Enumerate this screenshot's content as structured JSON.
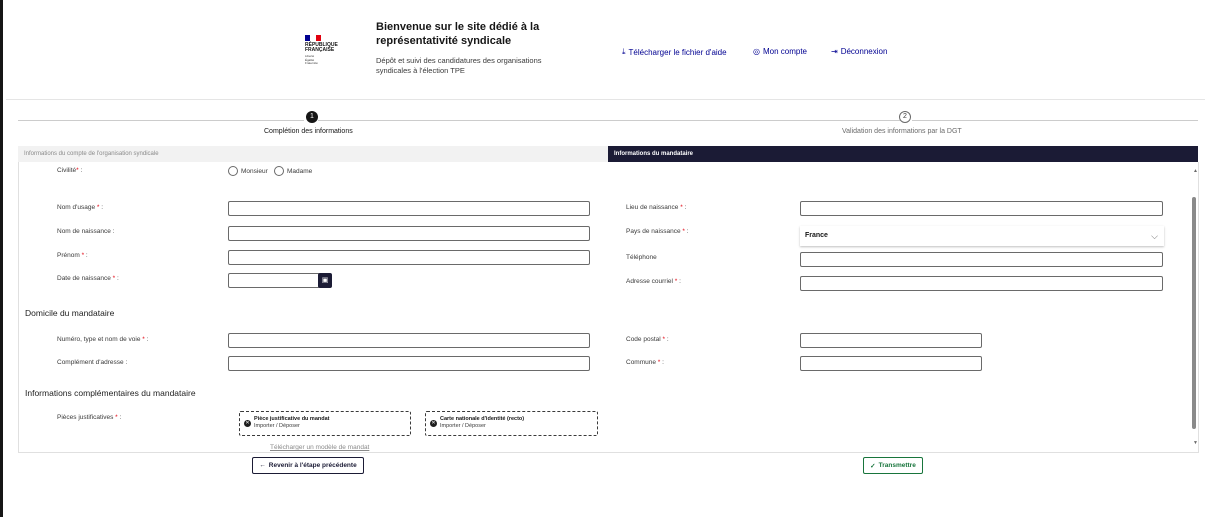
{
  "header": {
    "logo_title": "RÉPUBLIQUE\nFRANÇAISE",
    "logo_motto": "Liberté\nÉgalité\nFraternité",
    "title": "Bienvenue sur le site dédié à la représentativité syndicale",
    "description": "Dépôt et suivi des candidatures des organisations syndicales à l'élection TPE",
    "links": {
      "help": {
        "label": "Télécharger le fichier d'aide",
        "icon": "download-icon"
      },
      "account": {
        "label": "Mon compte",
        "icon": "user-circle-icon"
      },
      "logout": {
        "label": "Déconnexion",
        "icon": "logout-icon"
      }
    },
    "flag_colors": [
      "#000091",
      "#ffffff",
      "#e1000f"
    ]
  },
  "stepper": {
    "steps": [
      {
        "number": "1",
        "label": "Complétion des informations",
        "active": true
      },
      {
        "number": "2",
        "label": "Validation des informations par la DGT",
        "active": false
      }
    ]
  },
  "tabs": {
    "inactive": "Informations du compte de l'organisation syndicale",
    "active": "Informations du mandataire"
  },
  "form": {
    "civility": {
      "label": "Civilité",
      "options": [
        "Monsieur",
        "Madame"
      ]
    },
    "left_fields": {
      "usage_name": "Nom d'usage",
      "birth_name": "Nom de naissance :",
      "first_name": "Prénom",
      "birth_date": "Date de naissance"
    },
    "right_fields": {
      "birth_place": "Lieu de naissance",
      "birth_country": "Pays de naissance",
      "birth_country_value": "France",
      "phone": "Téléphone",
      "email": "Adresse courriel"
    },
    "domicile": {
      "title": "Domicile du mandataire",
      "street": "Numéro, type et nom de voie",
      "address_complement": "Complément d'adresse :",
      "postal_code": "Code postal",
      "city": "Commune"
    },
    "complementary": {
      "title": "Informations complémentaires du mandataire",
      "documents_label": "Pièces justificatives",
      "dropzones": [
        {
          "title": "Pièce justificative du mandat",
          "subtitle": "Importer / Déposer"
        },
        {
          "title": "Carte nationale d'identité (recto)",
          "subtitle": "Importer / Déposer"
        }
      ],
      "model_link": "Télécharger un modèle de mandat"
    },
    "required_suffix": "*",
    "required_color": "#e1000f"
  },
  "actions": {
    "back": "Revenir à l'étape précédente",
    "submit": "Transmettre"
  },
  "colors": {
    "primary": "#000091",
    "dark": "#1b1b35",
    "success": "#18753c"
  }
}
